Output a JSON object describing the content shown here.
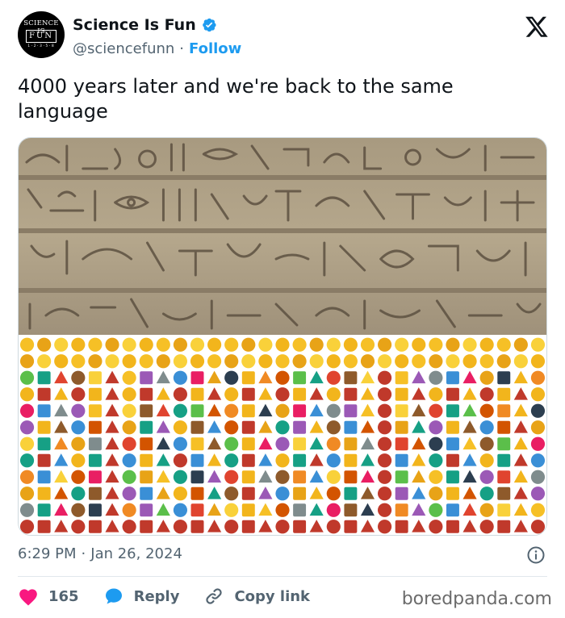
{
  "account": {
    "name": "Science Is Fun",
    "handle": "@sciencefunn",
    "separator": "·",
    "follow_label": "Follow",
    "avatar_logo_text": "SCIENCE IS FUN 1·2·3·5·8",
    "verified_color": "#1d9bf0"
  },
  "tweet": {
    "text": "4000 years later and we're back to the same language",
    "time": "6:29 PM",
    "time_separator": "·",
    "date": "Jan 26, 2024"
  },
  "media": {
    "top_panel": "egyptian-hieroglyphs-carving",
    "bottom_panel": "emoji-grid"
  },
  "actions": {
    "like_count": "165",
    "reply_label": "Reply",
    "copy_link_label": "Copy link",
    "like_color": "#f91880",
    "reply_color": "#1d9bf0"
  },
  "watermark": "boredpanda.com"
}
